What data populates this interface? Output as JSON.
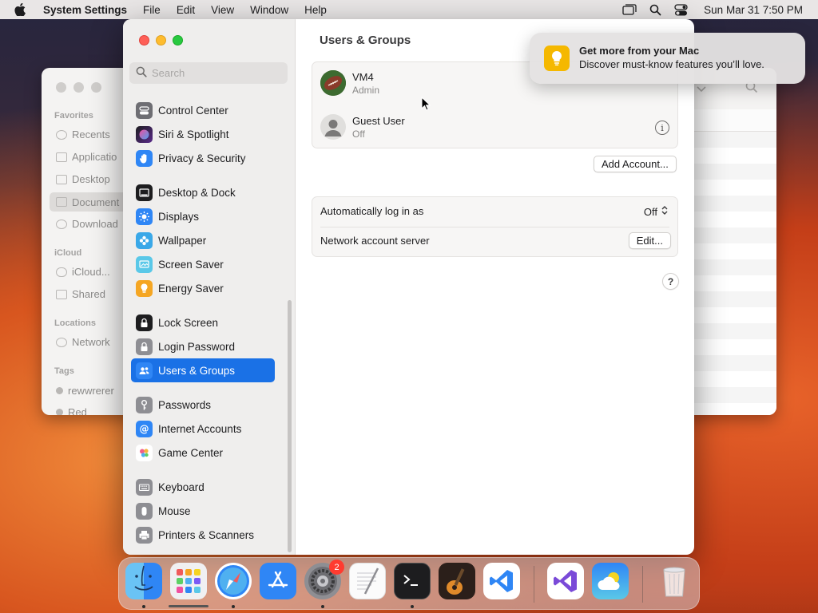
{
  "menubar": {
    "app_name": "System Settings",
    "items": [
      "File",
      "Edit",
      "View",
      "Window",
      "Help"
    ],
    "clock": "Sun Mar 31  7:50 PM"
  },
  "finder": {
    "sections": {
      "favorites": "Favorites",
      "icloud": "iCloud",
      "locations": "Locations",
      "tags": "Tags"
    },
    "items": {
      "recents": "Recents",
      "applications": "Applicatio",
      "desktop": "Desktop",
      "documents": "Document",
      "downloads": "Download",
      "icloud_drive": "iCloud...",
      "shared": "Shared",
      "network": "Network",
      "tag1": "rewwrerer",
      "tag2": "Red"
    }
  },
  "settings": {
    "search_placeholder": "Search",
    "sidebar": [
      {
        "label": "Control Center",
        "icon": "control-center-icon",
        "color": "#6e6e73"
      },
      {
        "label": "Siri & Spotlight",
        "icon": "siri-icon",
        "color": "#b83cd8"
      },
      {
        "label": "Privacy & Security",
        "icon": "hand-icon",
        "color": "#2f86f5"
      },
      {
        "label": "Desktop & Dock",
        "icon": "dock-icon",
        "color": "#1d1d1f"
      },
      {
        "label": "Displays",
        "icon": "sun-icon",
        "color": "#2f86f5"
      },
      {
        "label": "Wallpaper",
        "icon": "flower-icon",
        "color": "#3aa8e8"
      },
      {
        "label": "Screen Saver",
        "icon": "screen-saver-icon",
        "color": "#5ac8e8"
      },
      {
        "label": "Energy Saver",
        "icon": "bulb-icon",
        "color": "#f5a623"
      },
      {
        "label": "Lock Screen",
        "icon": "lock-icon",
        "color": "#1d1d1f"
      },
      {
        "label": "Login Password",
        "icon": "lock-icon",
        "color": "#8e8e93"
      },
      {
        "label": "Users & Groups",
        "icon": "users-icon",
        "color": "#2f86f5"
      },
      {
        "label": "Passwords",
        "icon": "key-icon",
        "color": "#8e8e93"
      },
      {
        "label": "Internet Accounts",
        "icon": "at-icon",
        "color": "#2f86f5"
      },
      {
        "label": "Game Center",
        "icon": "game-center-icon",
        "color": "#ffffff"
      },
      {
        "label": "Keyboard",
        "icon": "keyboard-icon",
        "color": "#8e8e93"
      },
      {
        "label": "Mouse",
        "icon": "mouse-icon",
        "color": "#8e8e93"
      },
      {
        "label": "Printers & Scanners",
        "icon": "printer-icon",
        "color": "#8e8e93"
      }
    ],
    "active_item": "Users & Groups",
    "main": {
      "title": "Users & Groups",
      "users": [
        {
          "name": "VM4",
          "role": "Admin"
        },
        {
          "name": "Guest User",
          "role": "Off"
        }
      ],
      "add_account": "Add Account...",
      "auto_login_label": "Automatically log in as",
      "auto_login_value": "Off",
      "network_server_label": "Network account server",
      "edit_button": "Edit...",
      "help": "?"
    }
  },
  "notification": {
    "title": "Get more from your Mac",
    "body": "Discover must-know features you’ll love."
  },
  "dock": {
    "apps": [
      "Finder",
      "Launchpad",
      "Safari",
      "App Store",
      "System Settings",
      "TextEdit",
      "Terminal",
      "GarageBand",
      "Visual Studio Code",
      "Visual Studio",
      "Weather",
      "Trash"
    ],
    "settings_badge": "2"
  },
  "colors": {
    "accent": "#1a71e6",
    "badge": "#ff3b30"
  }
}
